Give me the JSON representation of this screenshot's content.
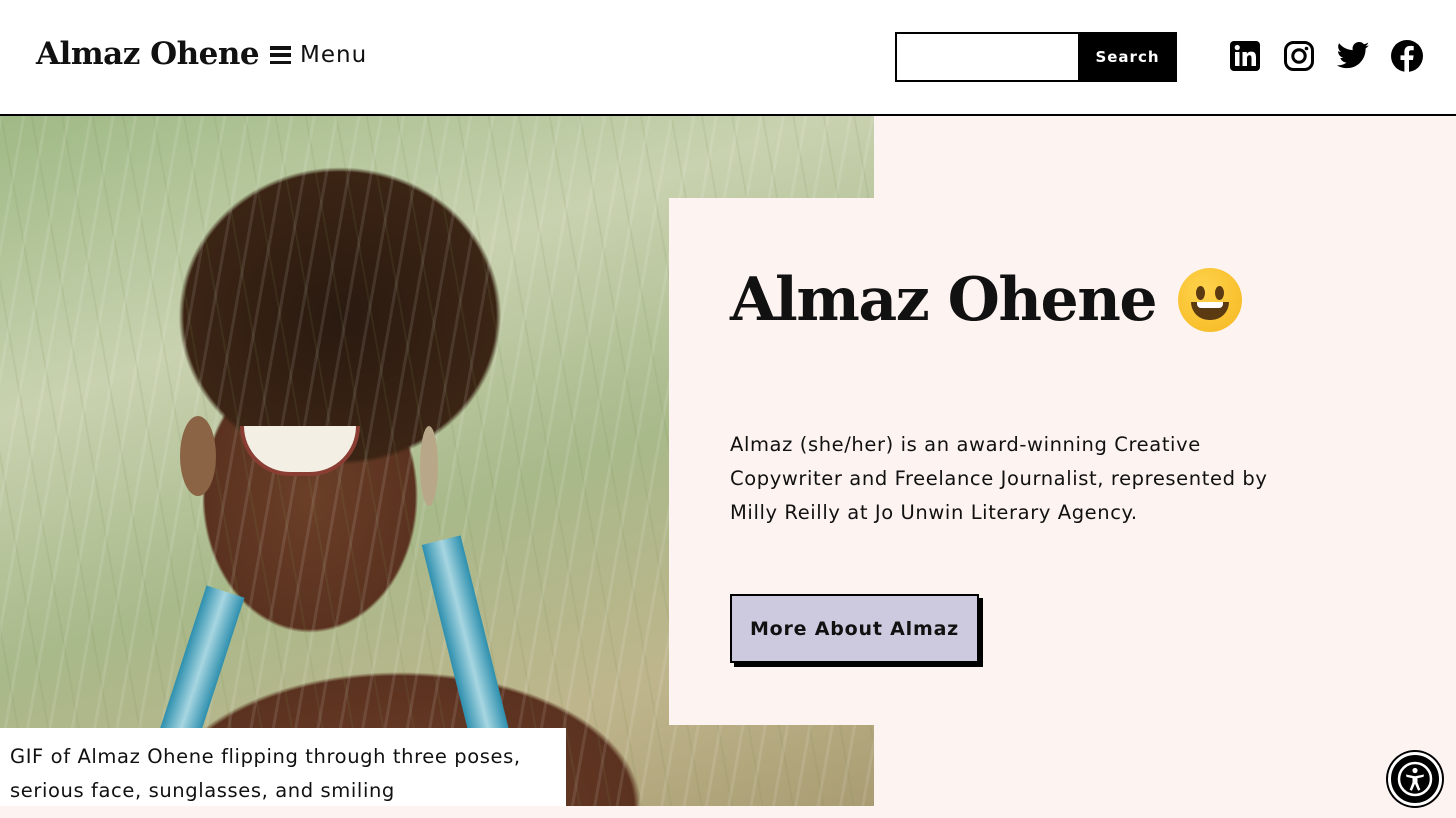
{
  "header": {
    "site_title": "Almaz Ohene",
    "menu_label": "Menu",
    "search": {
      "value": "",
      "placeholder": "",
      "button_label": "Search"
    },
    "socials": [
      {
        "icon": "linkedin-icon"
      },
      {
        "icon": "instagram-icon"
      },
      {
        "icon": "twitter-icon"
      },
      {
        "icon": "facebook-icon"
      }
    ]
  },
  "hero": {
    "title": "Almaz Ohene",
    "title_emoji": "grinning-face-emoji",
    "bio": "Almaz (she/her) is an award-winning Creative Copywriter and Freelance Journalist, represented by Milly Reilly at Jo Unwin Literary Agency.",
    "cta_label": "More About Almaz",
    "image_caption": "GIF of Almaz Ohene flipping through three poses, serious face, sunglasses, and smiling"
  },
  "accessibility_button": {
    "icon": "accessibility-icon"
  },
  "colors": {
    "background": "#fdf3f1",
    "cta_background": "#cdcae0",
    "header_background": "#ffffff",
    "text": "#111111"
  }
}
